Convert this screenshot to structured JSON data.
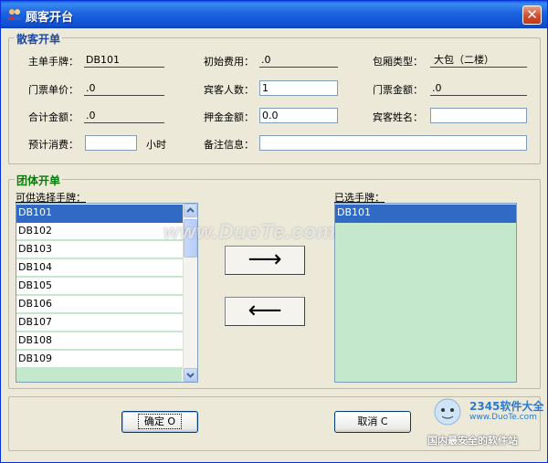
{
  "window": {
    "title": "顾客开台",
    "close_label": "✕"
  },
  "scatter_group": {
    "title": "散客开单",
    "fields": {
      "main_card": {
        "label": "主单手牌：",
        "value": "DB101"
      },
      "initial_fee": {
        "label": "初始费用：",
        "value": ".0"
      },
      "room_type": {
        "label": "包厢类型：",
        "value": "大包（二楼）"
      },
      "ticket_price": {
        "label": "门票单价：",
        "value": ".0"
      },
      "guest_count": {
        "label": "宾客人数：",
        "value": "1"
      },
      "ticket_amount": {
        "label": "门票金额：",
        "value": ".0"
      },
      "total_amount": {
        "label": "合计金额：",
        "value": ".0"
      },
      "deposit_amount": {
        "label": "押金金额：",
        "value": "0.0"
      },
      "guest_name": {
        "label": "宾客姓名：",
        "value": ""
      },
      "expected_spend": {
        "label": "预计消费：",
        "value": "",
        "unit": "小时"
      },
      "remarks": {
        "label": "备注信息：",
        "value": ""
      }
    }
  },
  "team_group": {
    "title": "团体开单",
    "available_label": "可供选择手牌：",
    "selected_label": "已选手牌：",
    "available_items": [
      "DB101",
      "DB102",
      "DB103",
      "DB104",
      "DB105",
      "DB106",
      "DB107",
      "DB108",
      "DB109"
    ],
    "selected_items": [
      "DB101"
    ],
    "move_right": "⟶",
    "move_left": "⟵"
  },
  "actions": {
    "confirm": "确定 O",
    "cancel": "取消 C"
  },
  "watermark": "www.DuoTe.com",
  "brand": {
    "logo": "2345软件大全",
    "url": "www.DuoTe.com",
    "slogan": "国内最安全的软件站"
  }
}
